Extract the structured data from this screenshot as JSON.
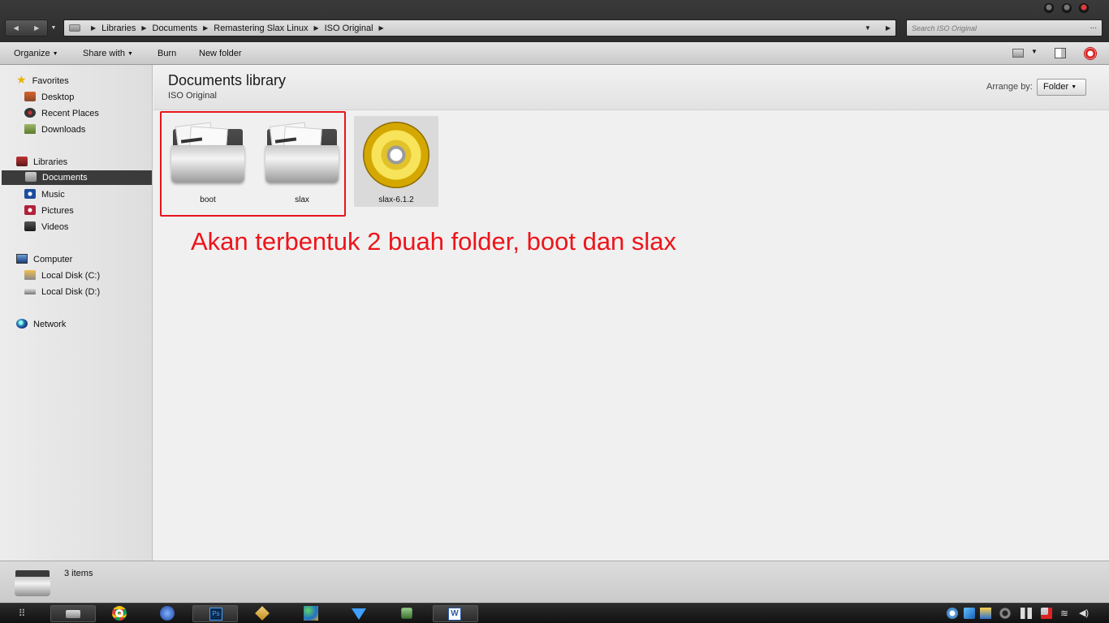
{
  "window": {
    "controls": [
      "minimize",
      "maximize",
      "close"
    ]
  },
  "address": {
    "crumbs": [
      "Libraries",
      "Documents",
      "Remastering Slax Linux",
      "ISO Original"
    ]
  },
  "search": {
    "placeholder": "Search ISO Original",
    "button": "..."
  },
  "toolbar": {
    "organize": "Organize",
    "share_with": "Share with",
    "burn": "Burn",
    "new_folder": "New folder"
  },
  "sidebar": {
    "favorites": "Favorites",
    "desktop": "Desktop",
    "recent_places": "Recent Places",
    "downloads": "Downloads",
    "libraries": "Libraries",
    "documents": "Documents",
    "music": "Music",
    "pictures": "Pictures",
    "videos": "Videos",
    "computer": "Computer",
    "local_disk_c": "Local Disk (C:)",
    "local_disk_d": "Local Disk (D:)",
    "network": "Network"
  },
  "library": {
    "title": "Documents library",
    "subtitle": "ISO Original",
    "arrange_label": "Arrange by:",
    "arrange_value": "Folder"
  },
  "files": [
    {
      "name": "boot",
      "type": "folder"
    },
    {
      "name": "slax",
      "type": "folder"
    },
    {
      "name": "slax-6.1.2",
      "type": "disc-image"
    }
  ],
  "annotation": "Akan terbentuk 2 buah folder, boot dan slax",
  "colors": {
    "annotation": "#ee141a",
    "selection": "#3b3b3b"
  },
  "details": {
    "count": "3 items"
  },
  "taskbar": {
    "apps": [
      "start-grid-icon",
      "explorer-icon",
      "chrome-icon",
      "browser-icon",
      "photoshop-icon",
      "app-icon",
      "paint-icon",
      "download-icon",
      "game-icon",
      "word-icon"
    ],
    "photoshop_label": "Ps",
    "word_label": "W"
  }
}
